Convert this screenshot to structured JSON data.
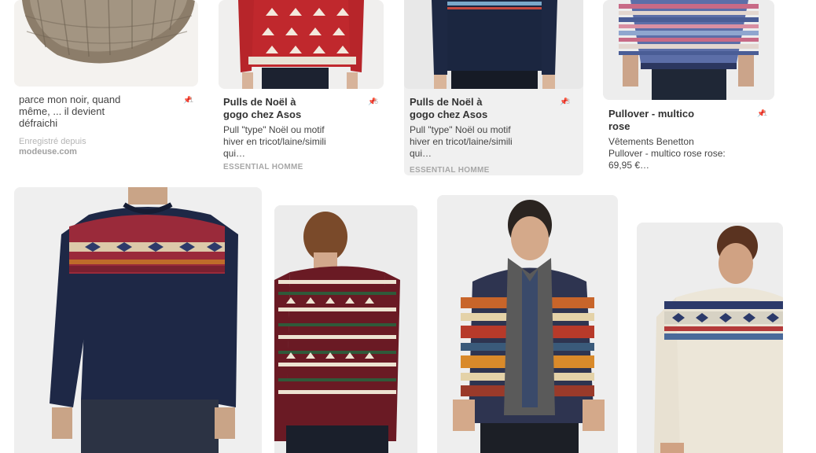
{
  "pins": [
    {
      "id": "pin1",
      "description": "parce mon noir, quand même, ... il devient défraichi",
      "saved_from_label": "Enregistré depuis",
      "saved_from_domain": "modeuse.com",
      "repins": "1"
    },
    {
      "id": "pin2",
      "title": "Pulls de Noël à gogo chez Asos",
      "description": "Pull \"type\" Noël ou motif hiver en tricot/laine/simili qui…",
      "source": "ESSENTIAL HOMME",
      "repins": "6"
    },
    {
      "id": "pin3",
      "title": "Pulls de Noël à gogo chez Asos",
      "description": "Pull \"type\" Noël ou motif hiver en tricot/laine/simili qui…",
      "source": "ESSENTIAL HOMME",
      "repins": "3"
    },
    {
      "id": "pin4",
      "title": "Pullover - multico rose",
      "description": "Vêtements Benetton Pullover - multico rose rose: 69,95 €…",
      "repins": "1"
    }
  ],
  "image_icons": [
    "hat-image",
    "red-reindeer-sweater-image",
    "navy-fairisle-sweater-image",
    "striped-multicolor-sweater-image",
    "navy-red-yoke-sweater-image",
    "reindeer-back-sweater-image",
    "shawl-cardigan-image",
    "cream-nordic-sweater-image"
  ],
  "colors": {
    "accent_grey": "#f0f0f0",
    "text": "#333333",
    "muted": "#a7a7a7"
  }
}
